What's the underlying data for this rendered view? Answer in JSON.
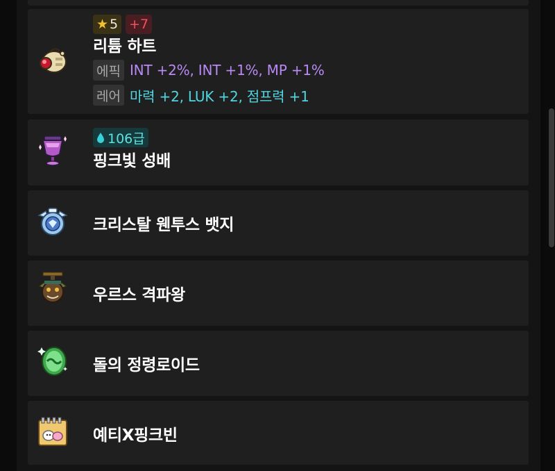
{
  "items": [
    {
      "name": "리튬 하트",
      "icon": "lithium-heart-icon",
      "star_count": "5",
      "enhance": "+7",
      "potential_tag": "에픽",
      "potential": "INT +2%, INT +1%, MP +1%",
      "additional_tag": "레어",
      "additional": "마력 +2, LUK +2, 점프력 +1"
    },
    {
      "name": "핑크빛 성배",
      "icon": "pink-chalice-icon",
      "grade": "106급"
    },
    {
      "name": "크리스탈 웬투스 뱃지",
      "icon": "crystal-badge-icon"
    },
    {
      "name": "우르스 격파왕",
      "icon": "urus-medal-icon"
    },
    {
      "name": "돌의 정령로이드",
      "icon": "stone-spirit-android-icon"
    },
    {
      "name": "예티X핑크빈",
      "icon": "yeti-pinkbean-icon"
    }
  ],
  "colors": {
    "background": "#141414",
    "card": "#1f1f1f",
    "epic": "#b98af5",
    "rare": "#4fd6e0",
    "star": "#f2c12e",
    "enhance": "#f0505e"
  }
}
